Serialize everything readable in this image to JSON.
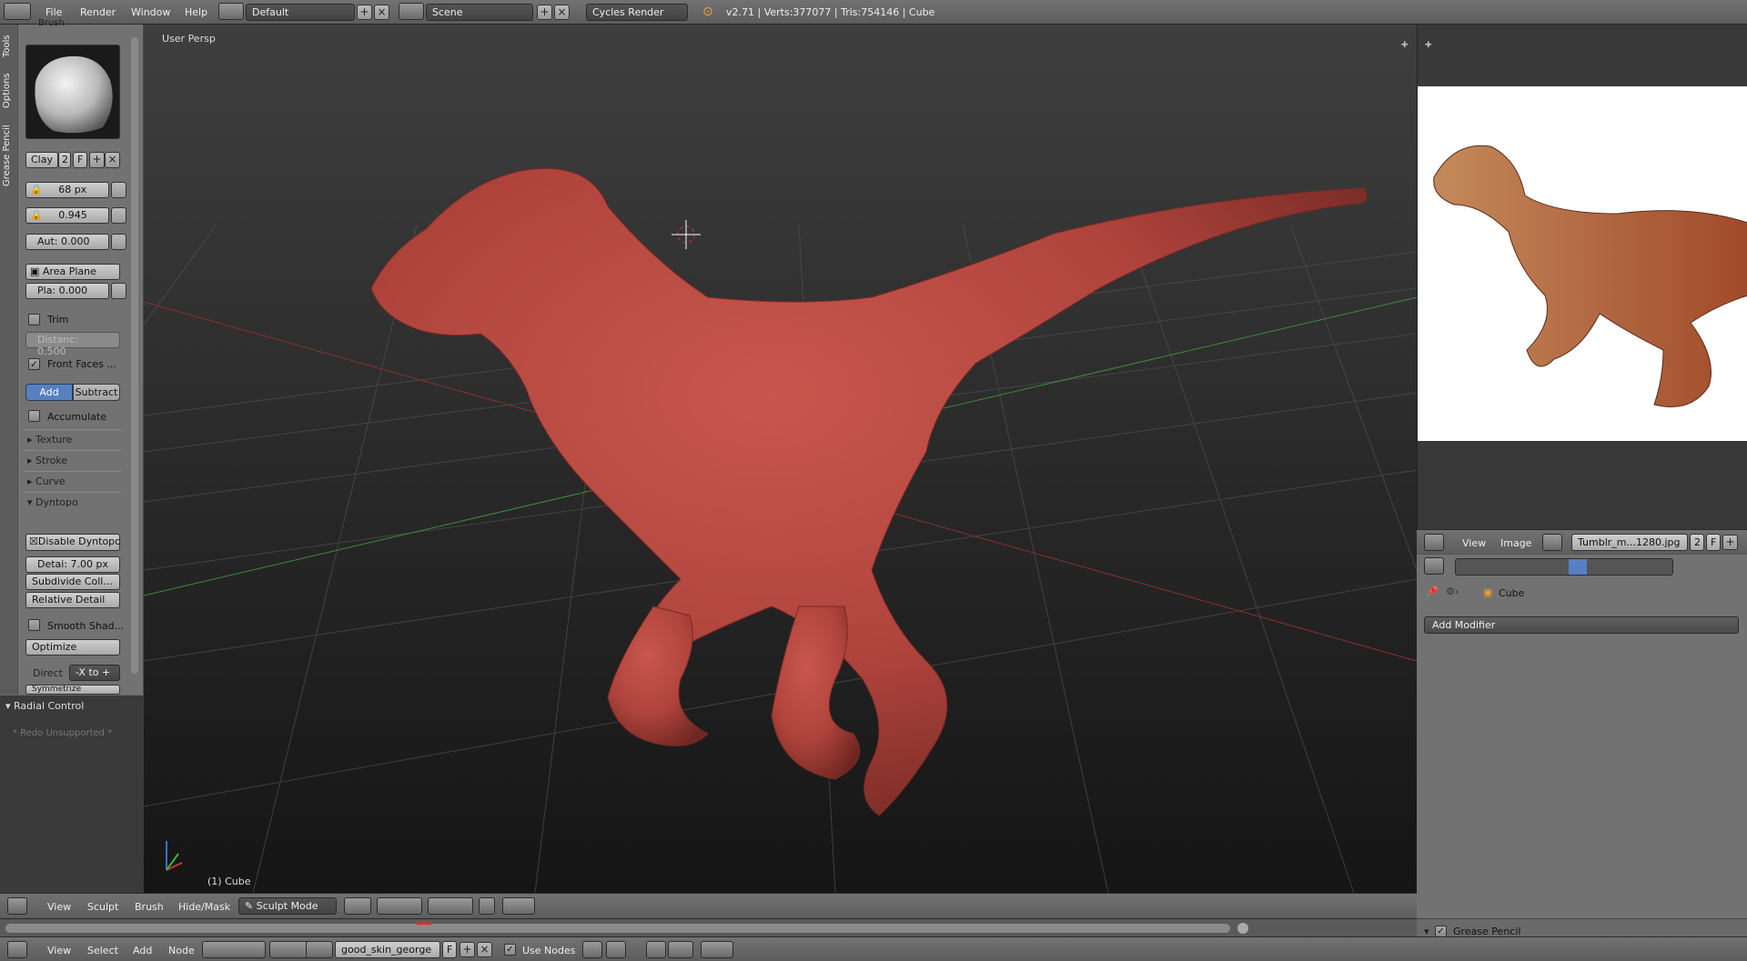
{
  "topbar": {
    "menus": [
      "File",
      "Render",
      "Window",
      "Help"
    ],
    "screen_layout": "Default",
    "scene": "Scene",
    "engine": "Cycles Render",
    "stats": "v2.71 | Verts:377077 | Tris:754146 | Cube"
  },
  "tool_shelf": {
    "tabs": [
      "Tools",
      "Options",
      "Grease Pencil"
    ],
    "brush_header": "Brush",
    "brush_name": "Clay",
    "brush_users": "2",
    "brush_fake": "F",
    "radius": "68 px",
    "strength": "0.945",
    "autosmooth": "Aut: 0.000",
    "sculpt_plane": "Area Plane",
    "plane_offset": "Pla: 0.000",
    "trim_label": "Trim",
    "trim_distance": "Distanc: 0.500",
    "front_faces_label": "Front Faces ...",
    "add_label": "Add",
    "subtract_label": "Subtract",
    "accumulate_label": "Accumulate",
    "panels": [
      "Texture",
      "Stroke",
      "Curve",
      "Dyntopo"
    ],
    "disable_dyntopo": "Disable Dyntopo",
    "detail_size": "Detai: 7.00 px",
    "detail_mode": "Subdivide Coll...",
    "detail_type": "Relative Detail",
    "smooth_shading": "Smooth Shad...",
    "optimize": "Optimize",
    "direction_label": "Direct",
    "direction_value": "-X to +",
    "symmetrize": "Symmetrize",
    "operator_panel": "Radial Control",
    "redo_text": "* Redo Unsupported *"
  },
  "viewport": {
    "view_label": "User Persp",
    "object_label": "(1) Cube"
  },
  "viewport_header": {
    "menus": [
      "View",
      "Sculpt",
      "Brush",
      "Hide/Mask"
    ],
    "mode": "Sculpt Mode"
  },
  "node_header": {
    "menus": [
      "View",
      "Select",
      "Add",
      "Node"
    ],
    "material": "good_skin_george",
    "fake": "F",
    "use_nodes": "Use Nodes"
  },
  "image_editor": {
    "menus": [
      "View",
      "Image"
    ],
    "image_name": "Tumblr_m...1280.jpg",
    "users": "2",
    "fake": "F"
  },
  "properties": {
    "object_name": "Cube",
    "add_modifier": "Add Modifier"
  },
  "timeline_right": {
    "grease_pencil": "Grease Pencil"
  },
  "colors": {
    "sculpt_clay": "#b0443d",
    "accent_blue": "#5680c2",
    "ui_gray": "#727272",
    "viewport_bg": "#2e2e2e"
  }
}
